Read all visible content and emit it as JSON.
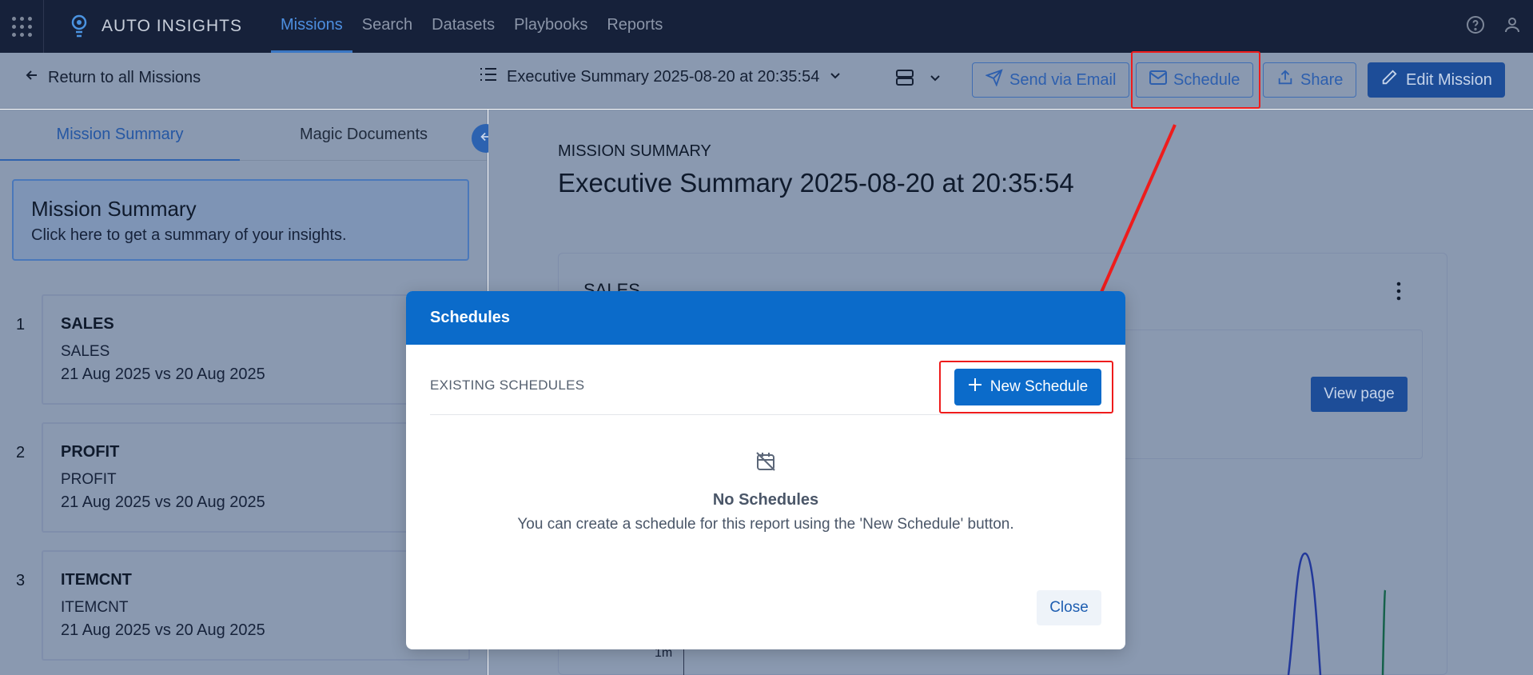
{
  "nav": {
    "brand": "AUTO INSIGHTS",
    "links": [
      {
        "label": "Missions"
      },
      {
        "label": "Search"
      },
      {
        "label": "Datasets"
      },
      {
        "label": "Playbooks"
      },
      {
        "label": "Reports"
      }
    ]
  },
  "toolbar": {
    "back_label": "Return to all Missions",
    "report_title": "Executive Summary 2025-08-20 at 20:35:54",
    "send_email_label": "Send via Email",
    "schedule_label": "Schedule",
    "share_label": "Share",
    "edit_label": "Edit Mission"
  },
  "sidebar": {
    "tabs": [
      {
        "label": "Mission Summary"
      },
      {
        "label": "Magic Documents"
      }
    ],
    "summary_title": "Mission Summary",
    "summary_desc": "Click here to get a summary of your insights.",
    "items": [
      {
        "num": "1",
        "title": "SALES",
        "sub": "SALES",
        "date": "21 Aug 2025 vs 20 Aug 2025"
      },
      {
        "num": "2",
        "title": "PROFIT",
        "sub": "PROFIT",
        "date": "21 Aug 2025 vs 20 Aug 2025"
      },
      {
        "num": "3",
        "title": "ITEMCNT",
        "sub": "ITEMCNT",
        "date": "21 Aug 2025 vs 20 Aug 2025"
      }
    ]
  },
  "main": {
    "eyebrow": "MISSION SUMMARY",
    "title": "Executive Summary 2025-08-20 at 20:35:54",
    "card_title": "SALES",
    "view_page_label": "View page",
    "axis_tick": "1m"
  },
  "dialog": {
    "title": "Schedules",
    "section_label": "EXISTING SCHEDULES",
    "new_schedule_label": "New Schedule",
    "empty_title": "No Schedules",
    "empty_desc": "You can create a schedule for this report using the 'New Schedule' button.",
    "close_label": "Close"
  },
  "colors": {
    "nav_bg": "#16213a",
    "accent": "#0b6bca",
    "highlight": "#ee1c1c"
  }
}
